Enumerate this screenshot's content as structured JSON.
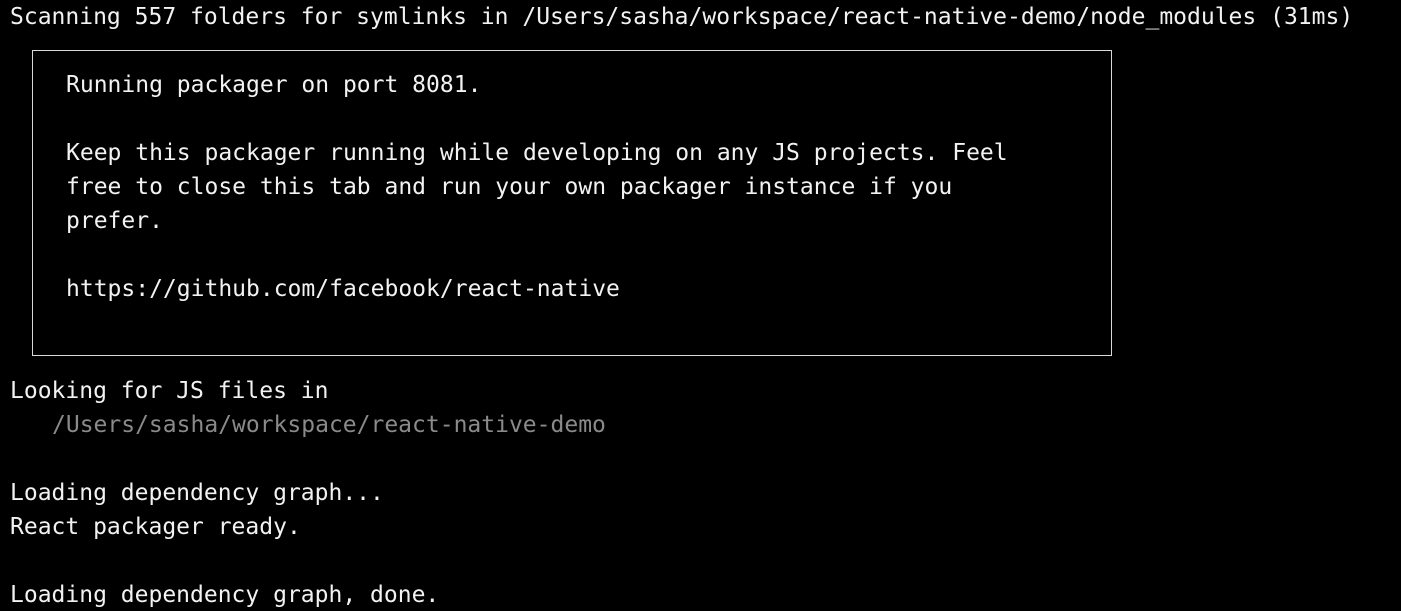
{
  "terminal": {
    "scan_line": "Scanning 557 folders for symlinks in /Users/sasha/workspace/react-native-demo/node_modules (31ms)",
    "box": {
      "title": "Running packager on port 8081.",
      "message_lines": [
        "Keep this packager running while developing on any JS projects. Feel",
        "free to close this tab and run your own packager instance if you",
        "prefer."
      ],
      "link": "https://github.com/facebook/react-native"
    },
    "looking_line": "Looking for JS files in",
    "looking_path": "/Users/sasha/workspace/react-native-demo",
    "loading_line": "Loading dependency graph...",
    "ready_line": "React packager ready.",
    "done_line": "Loading dependency graph, done."
  },
  "colors": {
    "background": "#000000",
    "text": "#f2f2f2",
    "dim_text": "#8a8a8a",
    "box_border": "#d8d8d8"
  }
}
